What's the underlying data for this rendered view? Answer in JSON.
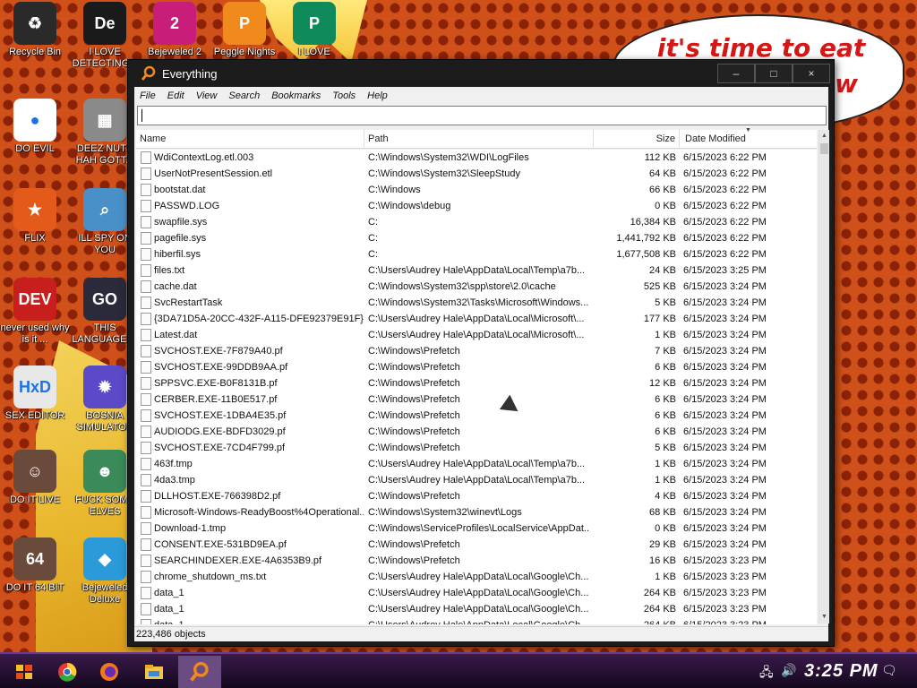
{
  "wallpaper": {
    "speech_line1": "it's time to eat shit",
    "speech_line2": "w"
  },
  "desktop_icons": [
    {
      "label": "Recycle Bin",
      "glyph": "♻",
      "color": "#2a2a2a"
    },
    {
      "label": "I LOVE DETECTING...",
      "glyph": "De",
      "color": "#1a1a1a"
    },
    {
      "label": "Bejeweled 2",
      "glyph": "2",
      "color": "#c81e7a"
    },
    {
      "label": "Peggle Nights",
      "glyph": "P",
      "color": "#f08a1c"
    },
    {
      "label": "I LOVE",
      "glyph": "P",
      "color": "#0f8a5a"
    },
    {
      "label": "DO EVIL",
      "glyph": "●",
      "color": "#ffffff"
    },
    {
      "label": "DEEZ NUTS HAH GOTT...",
      "glyph": "▦",
      "color": "#8a8a8a"
    },
    {
      "label": "FLIX",
      "glyph": "★",
      "color": "#e45a1a"
    },
    {
      "label": "ILL SPY ON YOU",
      "glyph": "⌕",
      "color": "#4a90c8"
    },
    {
      "label": "never used why is it ...",
      "glyph": "DEV",
      "color": "#c81e1e"
    },
    {
      "label": "THIS LANGUAGE ...",
      "glyph": "GO",
      "color": "#2a2a3a"
    },
    {
      "label": "SEX EDITOR",
      "glyph": "HxD",
      "color": "#e8e8e8"
    },
    {
      "label": "BOSNIA SIMULATOR",
      "glyph": "✹",
      "color": "#5a4ac8"
    },
    {
      "label": "DO IT LIVE",
      "glyph": "☺",
      "color": "#6a4a3a"
    },
    {
      "label": "FUCK SOME ELVES",
      "glyph": "☻",
      "color": "#3a8a5a"
    },
    {
      "label": "DO IT 64 BIT",
      "glyph": "64",
      "color": "#6a4a3a"
    },
    {
      "label": "Bejeweled Deluxe",
      "glyph": "◆",
      "color": "#2a9ad8"
    }
  ],
  "window": {
    "title": "Everything",
    "buttons": {
      "minimize": "–",
      "maximize": "□",
      "close": "×"
    },
    "menu": [
      "File",
      "Edit",
      "View",
      "Search",
      "Bookmarks",
      "Tools",
      "Help"
    ],
    "search": {
      "value": "",
      "placeholder": ""
    },
    "columns": {
      "name": "Name",
      "path": "Path",
      "size": "Size",
      "date": "Date Modified"
    },
    "rows": [
      {
        "name": "WdiContextLog.etl.003",
        "path": "C:\\Windows\\System32\\WDI\\LogFiles",
        "size": "112 KB",
        "date": "6/15/2023 6:22 PM"
      },
      {
        "name": "UserNotPresentSession.etl",
        "path": "C:\\Windows\\System32\\SleepStudy",
        "size": "64 KB",
        "date": "6/15/2023 6:22 PM"
      },
      {
        "name": "bootstat.dat",
        "path": "C:\\Windows",
        "size": "66 KB",
        "date": "6/15/2023 6:22 PM"
      },
      {
        "name": "PASSWD.LOG",
        "path": "C:\\Windows\\debug",
        "size": "0 KB",
        "date": "6/15/2023 6:22 PM"
      },
      {
        "name": "swapfile.sys",
        "path": "C:",
        "size": "16,384 KB",
        "date": "6/15/2023 6:22 PM"
      },
      {
        "name": "pagefile.sys",
        "path": "C:",
        "size": "1,441,792 KB",
        "date": "6/15/2023 6:22 PM"
      },
      {
        "name": "hiberfil.sys",
        "path": "C:",
        "size": "1,677,508 KB",
        "date": "6/15/2023 6:22 PM"
      },
      {
        "name": "files.txt",
        "path": "C:\\Users\\Audrey Hale\\AppData\\Local\\Temp\\a7b...",
        "size": "24 KB",
        "date": "6/15/2023 3:25 PM"
      },
      {
        "name": "cache.dat",
        "path": "C:\\Windows\\System32\\spp\\store\\2.0\\cache",
        "size": "525 KB",
        "date": "6/15/2023 3:24 PM"
      },
      {
        "name": "SvcRestartTask",
        "path": "C:\\Windows\\System32\\Tasks\\Microsoft\\Windows...",
        "size": "5 KB",
        "date": "6/15/2023 3:24 PM"
      },
      {
        "name": "{3DA71D5A-20CC-432F-A115-DFE92379E91F}...",
        "path": "C:\\Users\\Audrey Hale\\AppData\\Local\\Microsoft\\...",
        "size": "177 KB",
        "date": "6/15/2023 3:24 PM"
      },
      {
        "name": "Latest.dat",
        "path": "C:\\Users\\Audrey Hale\\AppData\\Local\\Microsoft\\...",
        "size": "1 KB",
        "date": "6/15/2023 3:24 PM"
      },
      {
        "name": "SVCHOST.EXE-7F879A40.pf",
        "path": "C:\\Windows\\Prefetch",
        "size": "7 KB",
        "date": "6/15/2023 3:24 PM"
      },
      {
        "name": "SVCHOST.EXE-99DDB9AA.pf",
        "path": "C:\\Windows\\Prefetch",
        "size": "6 KB",
        "date": "6/15/2023 3:24 PM"
      },
      {
        "name": "SPPSVC.EXE-B0F8131B.pf",
        "path": "C:\\Windows\\Prefetch",
        "size": "12 KB",
        "date": "6/15/2023 3:24 PM"
      },
      {
        "name": "CERBER.EXE-11B0E517.pf",
        "path": "C:\\Windows\\Prefetch",
        "size": "6 KB",
        "date": "6/15/2023 3:24 PM"
      },
      {
        "name": "SVCHOST.EXE-1DBA4E35.pf",
        "path": "C:\\Windows\\Prefetch",
        "size": "6 KB",
        "date": "6/15/2023 3:24 PM"
      },
      {
        "name": "AUDIODG.EXE-BDFD3029.pf",
        "path": "C:\\Windows\\Prefetch",
        "size": "6 KB",
        "date": "6/15/2023 3:24 PM"
      },
      {
        "name": "SVCHOST.EXE-7CD4F799.pf",
        "path": "C:\\Windows\\Prefetch",
        "size": "5 KB",
        "date": "6/15/2023 3:24 PM"
      },
      {
        "name": "463f.tmp",
        "path": "C:\\Users\\Audrey Hale\\AppData\\Local\\Temp\\a7b...",
        "size": "1 KB",
        "date": "6/15/2023 3:24 PM"
      },
      {
        "name": "4da3.tmp",
        "path": "C:\\Users\\Audrey Hale\\AppData\\Local\\Temp\\a7b...",
        "size": "1 KB",
        "date": "6/15/2023 3:24 PM"
      },
      {
        "name": "DLLHOST.EXE-766398D2.pf",
        "path": "C:\\Windows\\Prefetch",
        "size": "4 KB",
        "date": "6/15/2023 3:24 PM"
      },
      {
        "name": "Microsoft-Windows-ReadyBoost%4Operational...",
        "path": "C:\\Windows\\System32\\winevt\\Logs",
        "size": "68 KB",
        "date": "6/15/2023 3:24 PM"
      },
      {
        "name": "Download-1.tmp",
        "path": "C:\\Windows\\ServiceProfiles\\LocalService\\AppDat...",
        "size": "0 KB",
        "date": "6/15/2023 3:24 PM"
      },
      {
        "name": "CONSENT.EXE-531BD9EA.pf",
        "path": "C:\\Windows\\Prefetch",
        "size": "29 KB",
        "date": "6/15/2023 3:24 PM"
      },
      {
        "name": "SEARCHINDEXER.EXE-4A6353B9.pf",
        "path": "C:\\Windows\\Prefetch",
        "size": "16 KB",
        "date": "6/15/2023 3:23 PM"
      },
      {
        "name": "chrome_shutdown_ms.txt",
        "path": "C:\\Users\\Audrey Hale\\AppData\\Local\\Google\\Ch...",
        "size": "1 KB",
        "date": "6/15/2023 3:23 PM"
      },
      {
        "name": "data_1",
        "path": "C:\\Users\\Audrey Hale\\AppData\\Local\\Google\\Ch...",
        "size": "264 KB",
        "date": "6/15/2023 3:23 PM"
      },
      {
        "name": "data_1",
        "path": "C:\\Users\\Audrey Hale\\AppData\\Local\\Google\\Ch...",
        "size": "264 KB",
        "date": "6/15/2023 3:23 PM"
      },
      {
        "name": "data_1",
        "path": "C:\\Users\\Audrey Hale\\AppData\\Local\\Google\\Ch...",
        "size": "264 KB",
        "date": "6/15/2023 3:23 PM"
      }
    ],
    "status": "223,486 objects"
  },
  "taskbar": {
    "clock": "3:25 PM",
    "tray_icons": [
      "network-icon",
      "volume-icon",
      "notification-icon"
    ]
  }
}
